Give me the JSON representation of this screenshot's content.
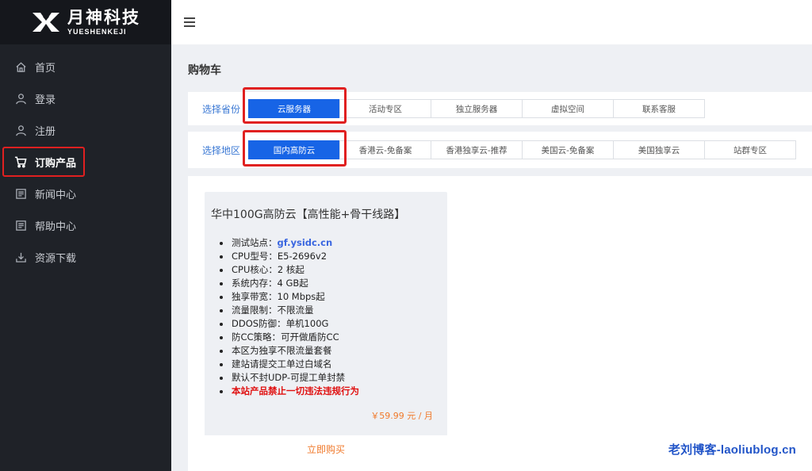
{
  "brand": {
    "name_cn": "月神科技",
    "name_en": "YUESHENKEJI"
  },
  "sidebar": {
    "items": [
      {
        "label": "首页",
        "icon": "home-icon"
      },
      {
        "label": "登录",
        "icon": "user-icon"
      },
      {
        "label": "注册",
        "icon": "user-add-icon"
      },
      {
        "label": "订购产品",
        "icon": "cart-icon",
        "active": true
      },
      {
        "label": "新闻中心",
        "icon": "news-icon"
      },
      {
        "label": "帮助中心",
        "icon": "help-icon"
      },
      {
        "label": "资源下载",
        "icon": "download-icon"
      }
    ]
  },
  "page": {
    "title": "购物车"
  },
  "filters": {
    "category": {
      "label": "选择省份",
      "options": [
        "云服务器",
        "活动专区",
        "独立服务器",
        "虚拟空间",
        "联系客服"
      ],
      "selected": "云服务器"
    },
    "region": {
      "label": "选择地区",
      "options": [
        "国内高防云",
        "香港云-免备案",
        "香港独享云-推荐",
        "美国云-免备案",
        "美国独享云",
        "站群专区"
      ],
      "selected": "国内高防云"
    }
  },
  "product": {
    "title": "华中100G高防云【高性能+骨干线路】",
    "specs": [
      {
        "key": "测试站点：",
        "value": "gf.ysidc.cn",
        "link": true
      },
      {
        "key": "CPU型号：",
        "value": "E5-2696v2"
      },
      {
        "key": "CPU核心：",
        "value": "2 核起"
      },
      {
        "key": "系统内存：",
        "value": "4 GB起"
      },
      {
        "key": "独享带宽：",
        "value": "10 Mbps起"
      },
      {
        "key": "流量限制：",
        "value": "不限流量"
      },
      {
        "key": "DDOS防御：",
        "value": "单机100G"
      },
      {
        "key": "防CC策略：",
        "value": "可开做盾防CC"
      },
      {
        "key": "本区为独享不限流量套餐",
        "value": ""
      },
      {
        "key": "建站请提交工单过白域名",
        "value": ""
      },
      {
        "key": "默认不封UDP-可提工单封禁",
        "value": ""
      },
      {
        "key": "本站产品禁止一切违法违规行为",
        "value": "",
        "warn": true
      }
    ],
    "price": "￥59.99 元 / 月",
    "buy_label": "立即购买"
  },
  "watermark": "老刘博客-laoliublog.cn",
  "colors": {
    "accent": "#1764e6",
    "highlight": "#e02020",
    "price": "#f07a2c",
    "sidebar_bg": "#1f2228"
  }
}
